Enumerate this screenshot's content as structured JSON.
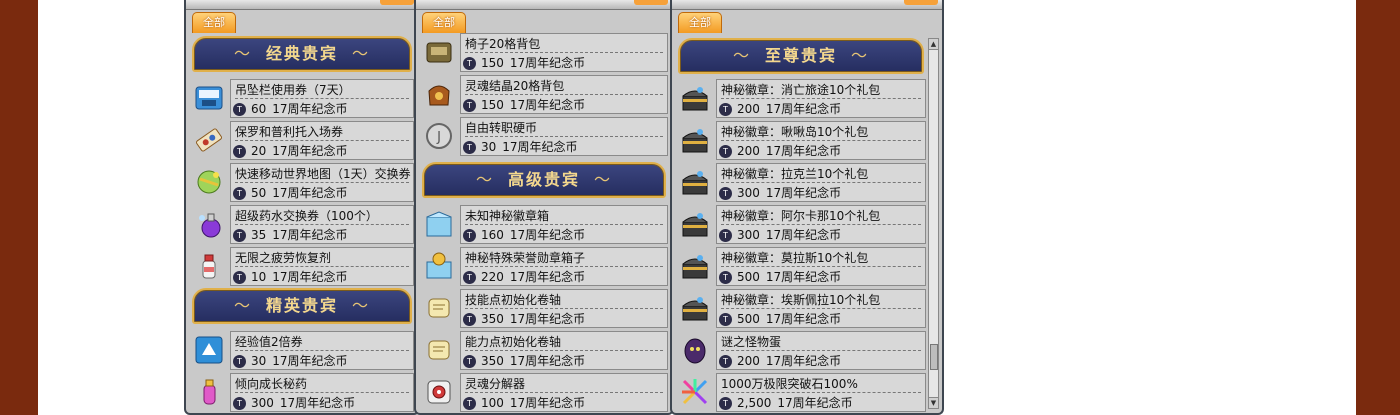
{
  "tab_label": "全部",
  "currency_label": "17周年纪念币",
  "coin_symbol": "T",
  "panels": [
    {
      "sections": [
        {
          "title": "经典贵宾",
          "items": [
            {
              "name": "吊坠栏使用券（7天）",
              "price": "60",
              "icon": "slot-ticket-icon"
            },
            {
              "name": "保罗和普利托入场券",
              "price": "20",
              "icon": "ticket-icon"
            },
            {
              "name": "快速移动世界地图（1天）交换券",
              "price": "50",
              "icon": "world-map-icon"
            },
            {
              "name": "超级药水交换券（100个）",
              "price": "35",
              "icon": "potion-icon"
            },
            {
              "name": "无限之疲劳恢复剂",
              "price": "10",
              "icon": "bottle-icon"
            }
          ]
        },
        {
          "title": "精英贵宾",
          "items": [
            {
              "name": "经验值2倍券",
              "price": "30",
              "icon": "exp-coupon-icon"
            },
            {
              "name": "倾向成长秘药",
              "price": "300",
              "icon": "elixir-icon"
            }
          ]
        }
      ]
    },
    {
      "sections": [
        {
          "title": "",
          "items": [
            {
              "name": "椅子20格背包",
              "price": "150",
              "icon": "chair-bag-icon"
            },
            {
              "name": "灵魂结晶20格背包",
              "price": "150",
              "icon": "soul-bag-icon"
            },
            {
              "name": "自由转职硬币",
              "price": "30",
              "icon": "job-coin-icon"
            }
          ]
        },
        {
          "title": "高级贵宾",
          "items": [
            {
              "name": "未知神秘徽章箱",
              "price": "160",
              "icon": "emblem-box-icon"
            },
            {
              "name": "神秘特殊荣誉勋章箱子",
              "price": "220",
              "icon": "medal-box-icon"
            },
            {
              "name": "技能点初始化卷轴",
              "price": "350",
              "icon": "scroll-icon"
            },
            {
              "name": "能力点初始化卷轴",
              "price": "350",
              "icon": "scroll-icon"
            },
            {
              "name": "灵魂分解器",
              "price": "100",
              "icon": "soul-decomposer-icon"
            }
          ]
        }
      ]
    },
    {
      "sections": [
        {
          "title": "至尊贵宾",
          "items": [
            {
              "name": "神秘徽章：消亡旅途10个礼包",
              "price": "200",
              "icon": "chest-icon"
            },
            {
              "name": "神秘徽章：啾啾岛10个礼包",
              "price": "200",
              "icon": "chest-icon"
            },
            {
              "name": "神秘徽章：拉克兰10个礼包",
              "price": "300",
              "icon": "chest-icon"
            },
            {
              "name": "神秘徽章：阿尔卡那10个礼包",
              "price": "300",
              "icon": "chest-icon"
            },
            {
              "name": "神秘徽章：莫拉斯10个礼包",
              "price": "500",
              "icon": "chest-icon"
            },
            {
              "name": "神秘徽章：埃斯佩拉10个礼包",
              "price": "500",
              "icon": "chest-icon"
            },
            {
              "name": "谜之怪物蛋",
              "price": "200",
              "icon": "monster-egg-icon"
            },
            {
              "name": "1000万极限突破石100%",
              "price": "2,500",
              "icon": "breakthrough-stone-icon"
            }
          ]
        }
      ]
    }
  ],
  "colors": {
    "background": "#7a2a0e",
    "banner": "#2a3266",
    "banner_border": "#e0b04a",
    "tab": "#f39a22"
  }
}
